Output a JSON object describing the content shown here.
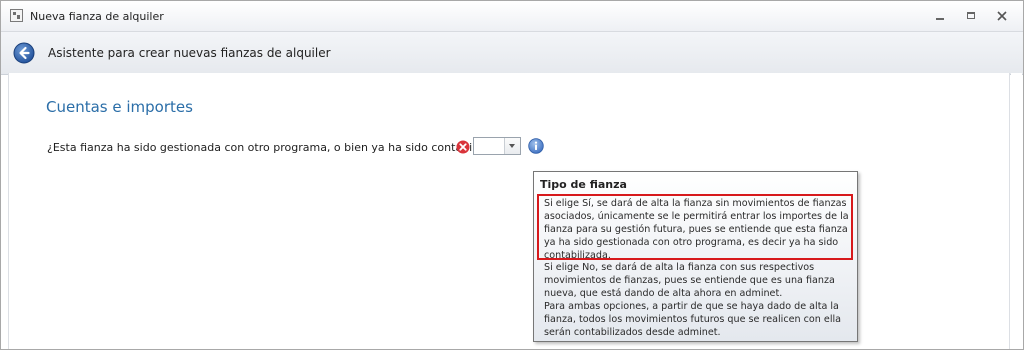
{
  "window": {
    "title": "Nueva fianza de alquiler"
  },
  "header": {
    "title": "Asistente para crear nuevas fianzas de alquiler"
  },
  "section": {
    "title": "Cuentas e importes"
  },
  "form": {
    "question_label": "¿Esta fianza ha sido gestionada con otro programa, o bien ya ha sido contabilizada?",
    "combo_value": ""
  },
  "icons": {
    "back": "back-arrow-icon",
    "error": "error-icon",
    "info": "info-icon",
    "minimize": "minimize-icon",
    "maximize": "maximize-icon",
    "close": "close-icon"
  },
  "colors": {
    "section_title": "#2b6ea8",
    "highlight": "#d7191c",
    "error": "#d9333a",
    "info": "#4a78c4"
  },
  "tooltip": {
    "title": "Tipo de fianza",
    "p1_lines": [
      "Si elige Sí, se dará de alta la fianza sin movimientos de fianzas",
      "asociados, únicamente se le permitirá entrar los importes de la",
      "fianza para su gestión futura, pues se entiende que esta fianza",
      "ya ha sido gestionada con otro programa, es decir ya ha sido",
      "contabilizada."
    ],
    "p2_lines": [
      "Si elige No, se dará de alta la fianza con sus respectivos",
      "movimientos de fianzas, pues se entiende que es una fianza",
      "nueva, que está dando de alta ahora en adminet."
    ],
    "p3_lines": [
      "Para ambas opciones, a partir de que se haya dado de alta la",
      "fianza, todos los movimientos futuros que se realicen con ella",
      "serán contabilizados desde adminet."
    ]
  }
}
